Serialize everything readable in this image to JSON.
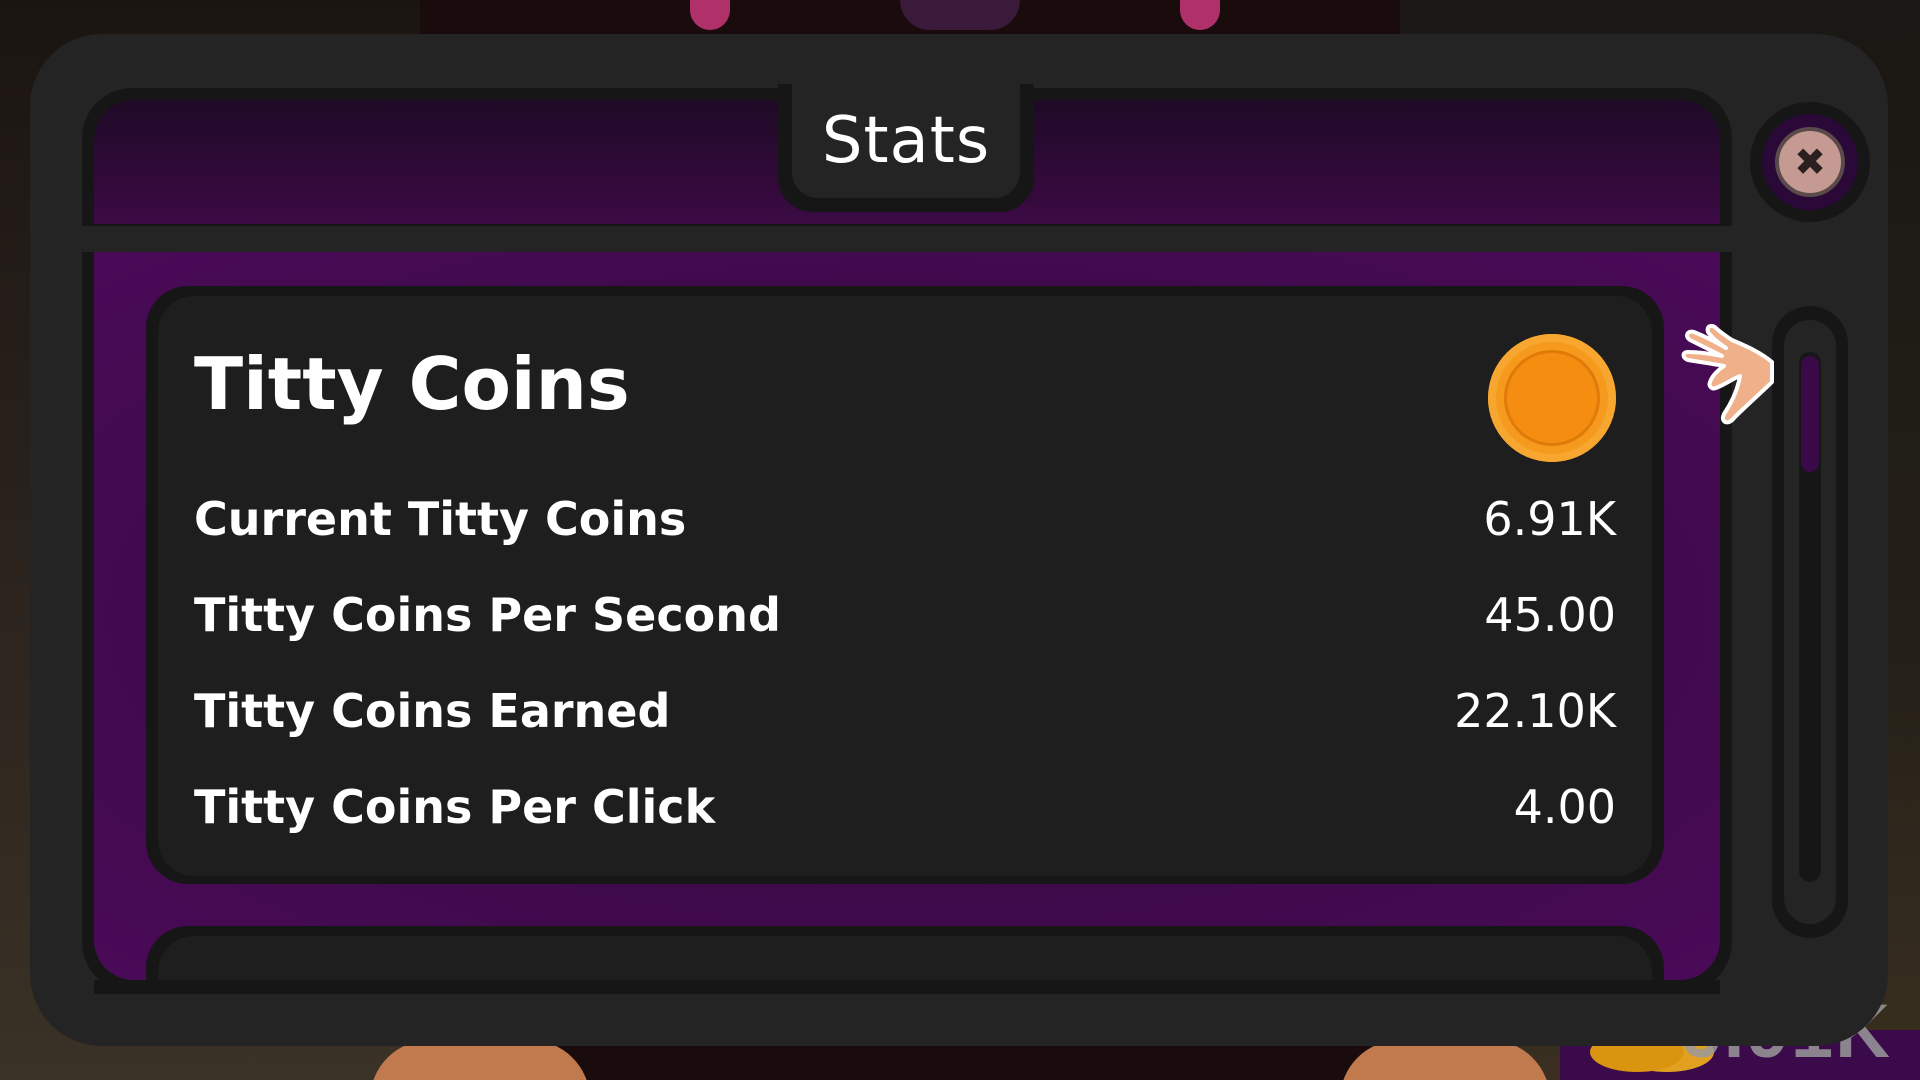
{
  "dialog": {
    "title": "Stats",
    "close_icon": "close-icon"
  },
  "section": {
    "title": "Titty Coins",
    "icon": "coin-icon",
    "rows": [
      {
        "label": "Current Titty Coins",
        "value": "6.91K"
      },
      {
        "label": "Titty Coins Per Second",
        "value": "45.00"
      },
      {
        "label": "Titty Coins Earned",
        "value": "22.10K"
      },
      {
        "label": "Titty Coins Per Click",
        "value": "4.00"
      }
    ]
  },
  "scrollbar": {
    "position_fraction": 0.0,
    "thumb_fraction": 0.22
  },
  "hud": {
    "coins": "6.91K"
  },
  "colors": {
    "panel": "#242424",
    "accent_purple": "#3e0a4a",
    "coin": "#f59a1c",
    "text": "#ffffff"
  }
}
